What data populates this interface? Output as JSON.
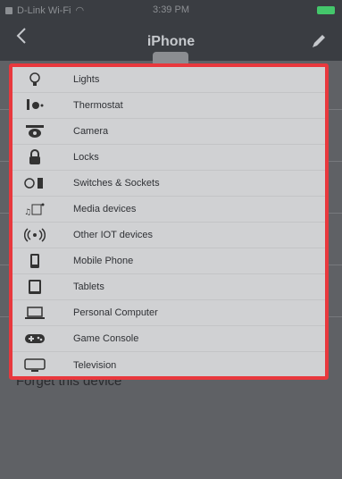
{
  "status_bar": {
    "carrier": "D-Link Wi-Fi",
    "time": "3:39 PM"
  },
  "nav": {
    "title": "iPhone",
    "back_icon": "chevron-left-icon",
    "edit_icon": "pencil-icon"
  },
  "background": {
    "forget_label": "Forget this device"
  },
  "menu": {
    "items": [
      {
        "label": "Lights",
        "icon": "lightbulb-icon"
      },
      {
        "label": "Thermostat",
        "icon": "thermostat-icon"
      },
      {
        "label": "Camera",
        "icon": "camera-icon"
      },
      {
        "label": "Locks",
        "icon": "lock-icon"
      },
      {
        "label": "Switches & Sockets",
        "icon": "socket-icon"
      },
      {
        "label": "Media devices",
        "icon": "media-icon"
      },
      {
        "label": "Other IOT devices",
        "icon": "wireless-icon"
      },
      {
        "label": "Mobile Phone",
        "icon": "phone-icon"
      },
      {
        "label": "Tablets",
        "icon": "tablet-icon"
      },
      {
        "label": "Personal Computer",
        "icon": "laptop-icon"
      },
      {
        "label": "Game Console",
        "icon": "gamepad-icon"
      },
      {
        "label": "Television",
        "icon": "tv-icon"
      }
    ],
    "highlight_color": "#e8383d"
  }
}
